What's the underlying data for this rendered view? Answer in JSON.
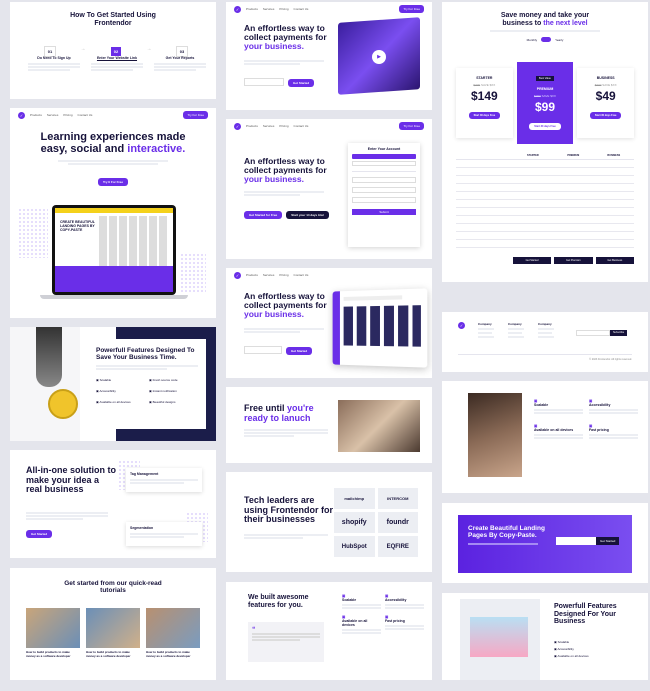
{
  "nav": {
    "menu": [
      "Products",
      "Services",
      "Pricing",
      "Contact Us"
    ],
    "cta": "Try For Free"
  },
  "steps": {
    "title": "How To Get Started Using Frontendor",
    "items": [
      {
        "num": "01",
        "title": "Do Need To Sign Up"
      },
      {
        "num": "02",
        "title": "Enter Your Website Link"
      },
      {
        "num": "03",
        "title": "Get Your Reports"
      }
    ]
  },
  "hero_video": {
    "title_a": "An effortless way to collect payments for",
    "title_b": "your business.",
    "btn": "Get Started"
  },
  "pricing": {
    "title_a": "Save money and take your business to",
    "title_b": "the next level",
    "toggle_a": "Monthly",
    "toggle_b": "Yearly",
    "badge": "Best Value",
    "plans": [
      {
        "name": "STARTER",
        "old": "$300",
        "save": "SAVE $XX",
        "price": "$149",
        "btn": "Start 30 days Free"
      },
      {
        "name": "PREMIUM",
        "old": "$200",
        "save": "SAVE $XX",
        "price": "$99",
        "btn": "Start 30 days Free"
      },
      {
        "name": "BUSINESS",
        "old": "$300",
        "save": "SAVE $XX",
        "price": "$49",
        "btn": "Start 30 days Free"
      }
    ],
    "table_headers": [
      "STARTER",
      "PREMIUM",
      "BUSINESS"
    ],
    "buttons": [
      "Get Started",
      "Get Premium",
      "Get Business"
    ]
  },
  "learning": {
    "title_a": "Learning experiences made easy, social and",
    "title_b": "interactive.",
    "btn": "Try It For Free",
    "screen_title": "CREATE BEAUTIFUL LANDING PAGES BY COPY-PASTE"
  },
  "form_hero": {
    "title_a": "An effortless way to collect payments for",
    "title_b": "your business.",
    "btn_a": "Get Started for Free",
    "btn_b": "Start your 14 days trial",
    "form_title": "Enter Your Account",
    "form_btn": "Submit"
  },
  "footer": {
    "cols": [
      "Company",
      "Company",
      "Company"
    ],
    "news_btn": "Subscribe",
    "copyright": "© 2023 Frontendor. All rights reserved."
  },
  "features_hand": {
    "title": "Powerfull Features Designed To Save Your Business Time.",
    "items": [
      "Scalable",
      "Fresh source code",
      "Accessibility",
      "Instant notification",
      "Available on all devices",
      "Beautiful designs"
    ]
  },
  "dashboard_hero": {
    "title_a": "An effortless way to collect payments for",
    "title_b": "your business.",
    "btn": "Get Started"
  },
  "features_photo": {
    "items": [
      "Scalable",
      "Accessibility",
      "Available on all devices",
      "Fast pricing"
    ]
  },
  "free_trial": {
    "title_a": "Free until",
    "title_b": "you're ready to lanuch",
    "btn": "Get Started Now"
  },
  "allinone": {
    "title": "All-in-one solution to make your idea a real business",
    "btn": "Get Started",
    "tag1": "Tag Management",
    "tag2": "Segmentation"
  },
  "cta_banner": {
    "title": "Create Beautiful Landing Pages By Copy-Paste.",
    "btn": "Get Started"
  },
  "tech": {
    "title": "Tech leaders are using Frontendor for their businesses",
    "logos": [
      "mailchimp",
      "INTERCOM",
      "shopify",
      "foundr",
      "HubSpot",
      "EQFIRE"
    ]
  },
  "tutorials": {
    "title": "Get started from our quick-read tutorials",
    "items": [
      "How to build products to make money as a software developer",
      "How to build products to make money as a software developer",
      "How to build products to make money as a software developer"
    ]
  },
  "awesome": {
    "title": "We built awesome features for you.",
    "items": [
      "Scalable",
      "Accessibility",
      "Available on all devices",
      "Fast pricing"
    ]
  },
  "powerfull_b": {
    "title": "Powerfull Features Designed For Your Business",
    "items": [
      "Scalable",
      "Accessibility",
      "Available on all devices"
    ]
  },
  "colors": {
    "accent": "#6a2ee8",
    "dark": "#16123a",
    "navy": "#1b1d4a"
  }
}
